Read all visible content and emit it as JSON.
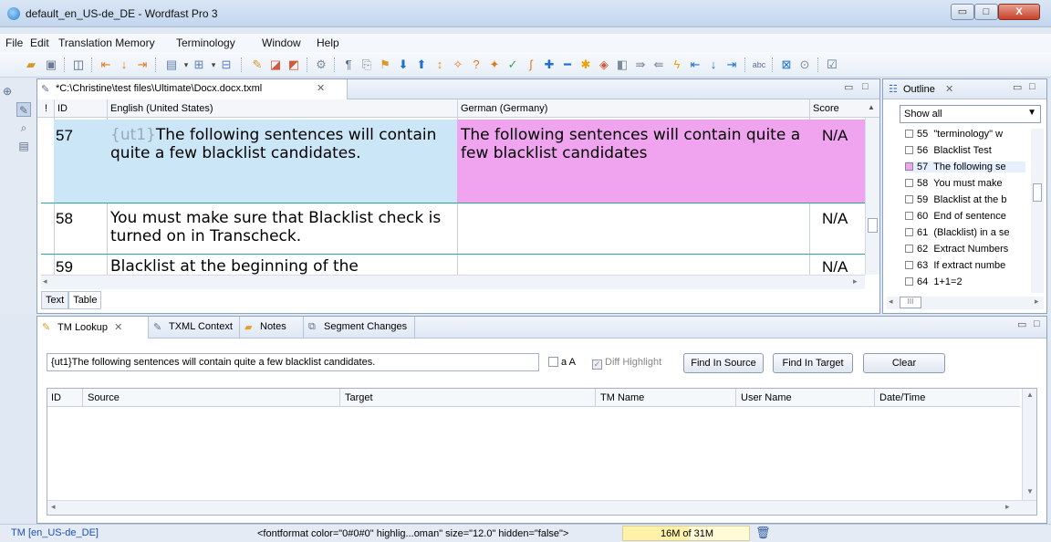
{
  "window": {
    "title": "default_en_US-de_DE - Wordfast Pro 3",
    "minimize": "▭",
    "maximize": "□",
    "close": "X"
  },
  "menu": [
    "File",
    "Edit",
    "Translation Memory",
    "Terminology",
    "Window",
    "Help"
  ],
  "editor": {
    "tab_title": "*C:\\Christine\\test files\\Ultimate\\Docx.docx.txml",
    "columns": {
      "flag": "!",
      "id": "ID",
      "source": "English (United States)",
      "target": "German (Germany)",
      "score": "Score"
    },
    "rows": [
      {
        "id": "57",
        "source_tag": "{ut1}",
        "source": "The following sentences will contain quite a few blacklist candidates.",
        "target": "The following sentences will contain quite a few blacklist candidates",
        "score": "N/A"
      },
      {
        "id": "58",
        "source": "You must make sure that Blacklist check is turned on in Transcheck.",
        "target": "",
        "score": "N/A"
      },
      {
        "id": "59",
        "source": "Blacklist at the beginning of the",
        "target": "",
        "score": "N/A"
      }
    ],
    "view_tabs": [
      "Text",
      "Table"
    ]
  },
  "outline": {
    "title": "Outline",
    "filter": "Show all",
    "items": [
      {
        "num": "55",
        "text": "\"terminology\" w"
      },
      {
        "num": "56",
        "text": "Blacklist Test"
      },
      {
        "num": "57",
        "text": "The following se"
      },
      {
        "num": "58",
        "text": "You must make"
      },
      {
        "num": "59",
        "text": "Blacklist at the b"
      },
      {
        "num": "60",
        "text": "End of sentence"
      },
      {
        "num": "61",
        "text": "(Blacklist) in a se"
      },
      {
        "num": "62",
        "text": "Extract Numbers"
      },
      {
        "num": "63",
        "text": "If extract numbe"
      },
      {
        "num": "64",
        "text": "1+1=2"
      }
    ],
    "scroll_indicator": "III"
  },
  "bottom": {
    "tabs": [
      "TM Lookup",
      "TXML Context",
      "Notes",
      "Segment Changes"
    ],
    "lookup_text": "{ut1}The following sentences will contain quite a few blacklist candidates.",
    "case_label": "a A",
    "diff_label": "Diff Highlight",
    "buttons": {
      "find_source": "Find In Source",
      "find_target": "Find In Target",
      "clear": "Clear"
    },
    "columns": [
      "ID",
      "Source",
      "Target",
      "TM Name",
      "User Name",
      "Date/Time"
    ]
  },
  "status": {
    "tm": "TM [en_US-de_DE]",
    "fontformat": "<fontformat color=\"0#0#0\" highlig...oman\" size=\"12.0\" hidden=\"false\">",
    "memory": "16M of 31M",
    "memory_used_fraction": 0.52
  },
  "colors": {
    "active_source_bg": "#cbe6f7",
    "active_target_bg": "#f0a3ee",
    "grid_line": "#2aa9a0"
  }
}
